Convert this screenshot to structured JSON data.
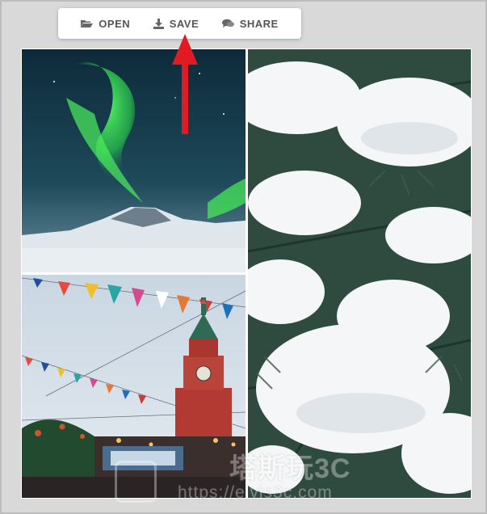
{
  "toolbar": {
    "open_label": "OPEN",
    "save_label": "SAVE",
    "share_label": "SHARE",
    "open_icon": "folder-open-icon",
    "save_icon": "download-icon",
    "share_icon": "speech-bubbles-icon"
  },
  "annotation": {
    "arrow_color": "#e01b24",
    "points_to": "save-button"
  },
  "collage": {
    "photos": [
      {
        "name": "aurora-photo",
        "subject": "northern lights over snowy mountain"
      },
      {
        "name": "snowy-pine-photo",
        "subject": "snow-covered pine branches"
      },
      {
        "name": "kremlin-photo",
        "subject": "Spasskaya tower with festive bunting"
      }
    ]
  },
  "watermark": {
    "brand": "塔斯玩3C",
    "url": "https://elvis3c.com"
  },
  "colors": {
    "frame_bg": "#d9d9d9",
    "toolbar_text": "#555555",
    "arrow": "#e01b24"
  }
}
